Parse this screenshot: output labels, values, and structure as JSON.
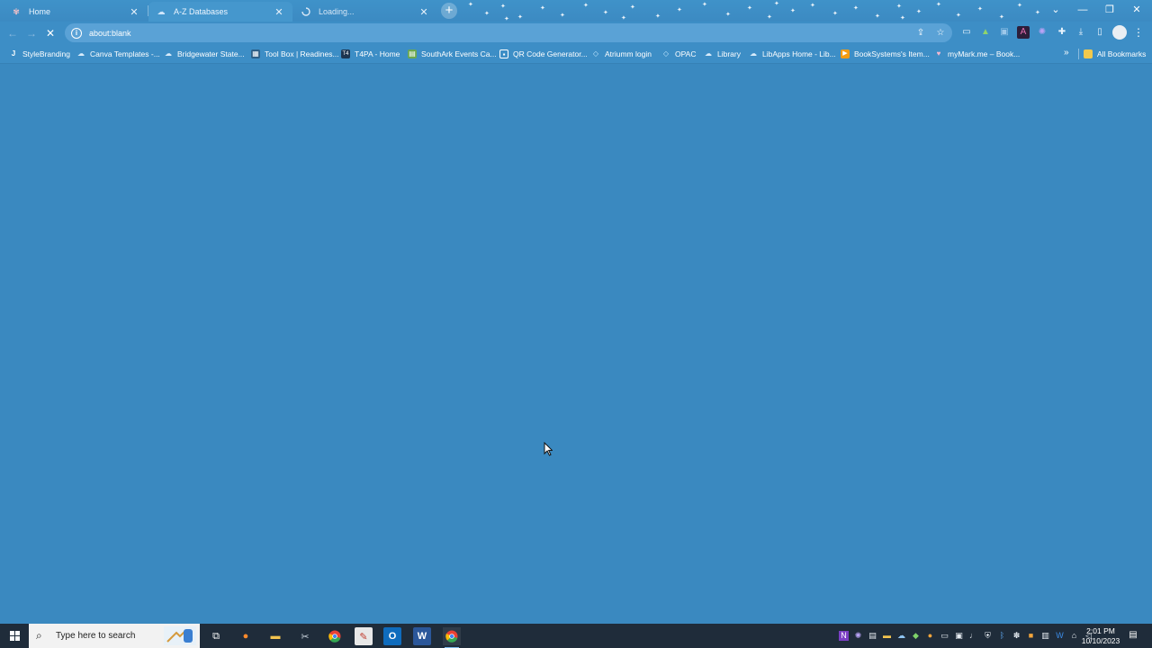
{
  "browser": {
    "tabs": [
      {
        "title": "Home",
        "favicon": "ornament-icon",
        "active": false
      },
      {
        "title": "A-Z Databases",
        "favicon": "cloud-icon",
        "active": true
      },
      {
        "title": "Loading...",
        "favicon": "spinner-icon",
        "active": false
      }
    ],
    "new_tab_label": "+",
    "window_controls": {
      "dropdown": "⌄",
      "minimize": "—",
      "restore": "❐",
      "close": "✕"
    },
    "address_bar": {
      "url": "about:blank"
    },
    "bookmarks": [
      {
        "label": "StyleBranding",
        "icon": "j-icon"
      },
      {
        "label": "Canva Templates -...",
        "icon": "cloud-icon"
      },
      {
        "label": "Bridgewater State...",
        "icon": "cloud-icon"
      },
      {
        "label": "Tool Box | Readines...",
        "icon": "grid-icon"
      },
      {
        "label": "T4PA - Home",
        "icon": "t4-icon"
      },
      {
        "label": "SouthArk Events Ca...",
        "icon": "calendar-icon"
      },
      {
        "label": "QR Code Generator...",
        "icon": "qr-icon"
      },
      {
        "label": "Atriumm login",
        "icon": "diamond-icon"
      },
      {
        "label": "OPAC",
        "icon": "diamond-icon"
      },
      {
        "label": "Library",
        "icon": "cloud-icon"
      },
      {
        "label": "LibApps Home - Lib...",
        "icon": "cloud-icon"
      },
      {
        "label": "BookSystems's Item...",
        "icon": "play-icon"
      },
      {
        "label": "myMark.me – Book...",
        "icon": "bookmark-icon"
      }
    ],
    "bookmarks_overflow": "»",
    "all_bookmarks": "All Bookmarks"
  },
  "taskbar": {
    "search_placeholder": "Type here to search",
    "clock_time": "2:01 PM",
    "clock_date": "10/10/2023"
  },
  "colors": {
    "page_background": "#3a89c0",
    "taskbar": "#1f2c3a"
  }
}
